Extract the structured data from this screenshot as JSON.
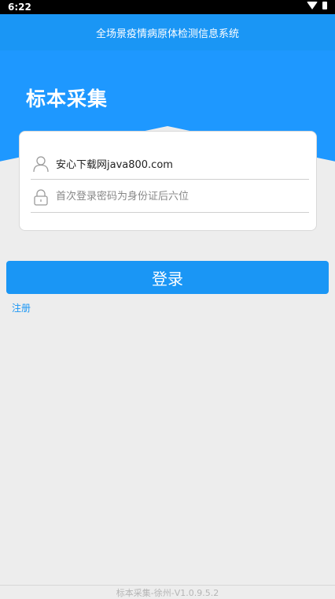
{
  "status_bar": {
    "time": "6:22"
  },
  "app_bar": {
    "title": "全场景疫情病原体检测信息系统"
  },
  "hero": {
    "title": "标本采集"
  },
  "login_form": {
    "username_value": "安心下载网java800.com",
    "password_placeholder": "首次登录密码为身份证后六位"
  },
  "actions": {
    "login_label": "登录",
    "register_label": "注册"
  },
  "footer": {
    "version": "标本采集-徐州-V1.0.9.5.2"
  },
  "icons": {
    "user": "user-icon",
    "lock": "lock-icon",
    "wifi": "wifi-icon",
    "battery": "battery-icon"
  },
  "colors": {
    "accent": "#1a96f5",
    "background": "#ededed"
  }
}
